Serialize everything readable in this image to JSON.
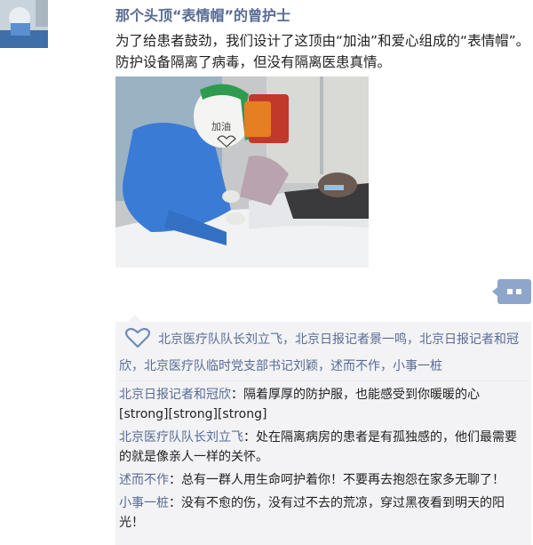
{
  "post": {
    "title": "那个头顶“表情帽”的曾护士",
    "text": "为了给患者鼓劲，我们设计了这顶由“加油”和爱心组成的“表情帽”。防护设备隔离了病毒，但没有隔离医患真情。",
    "photo_hat_text": "加油"
  },
  "likes": {
    "names": "北京医疗队队长刘立飞，北京日报记者景一鸣，北京日报记者和冠欣，北京医疗队临时党支部书记刘颖，述而不作，小事一桩"
  },
  "comments": [
    {
      "author": "北京日报记者和冠欣",
      "sep": "：",
      "text": "隔着厚厚的防护服，也能感受到你暖暖的心[strong][strong][strong]"
    },
    {
      "author": "北京医疗队队长刘立飞",
      "sep": "：",
      "text": "处在隔离病房的患者是有孤独感的，他们最需要的就是像亲人一样的关怀。"
    },
    {
      "author": "述而不作",
      "sep": "：",
      "text": "总有一群人用生命呵护着你！不要再去抱怨在家多无聊了！"
    },
    {
      "author": "小事一桩",
      "sep": "：",
      "text": "没有不愈的伤，没有过不去的荒凉，穿过黑夜看到明天的阳光！"
    }
  ],
  "icons": {
    "like": "heart-icon",
    "comment": "comment-dots-icon"
  },
  "colors": {
    "name_link": "#576b95",
    "panel_bg": "#f3f3f5",
    "comment_button": "#8ea6c9"
  }
}
